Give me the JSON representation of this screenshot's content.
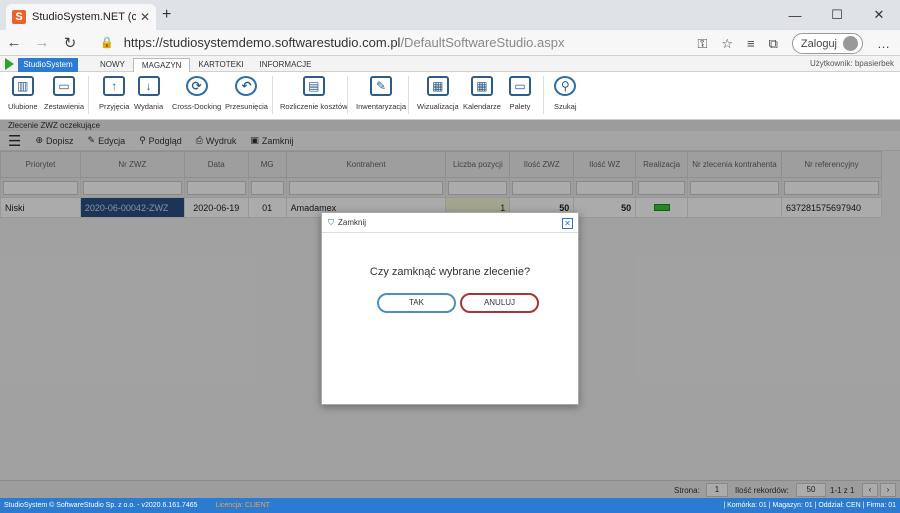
{
  "browser": {
    "tab_title": "StudioSystem.NET (c) SoftwareSt",
    "url_host": "https://studiosystemdemo.softwarestudio.com.pl",
    "url_path": "/DefaultSoftwareStudio.aspx",
    "login_label": "Zaloguj"
  },
  "app": {
    "studio_tab": "StudioSystem",
    "menu": [
      "NOWY",
      "MAGAZYN",
      "KARTOTEKI",
      "INFORMACJE"
    ],
    "active_menu": "MAGAZYN",
    "user": "Użytkownik: bpasierbek"
  },
  "ribbon": [
    {
      "label": "Ulubione",
      "icon": "favorites-icon"
    },
    {
      "label": "Zestawienia",
      "icon": "folder-icon"
    },
    {
      "label": "Przyjęcia",
      "icon": "receipt-in-icon"
    },
    {
      "label": "Wydania",
      "icon": "issue-out-icon"
    },
    {
      "label": "Cross-Docking",
      "icon": "refresh-icon"
    },
    {
      "label": "Przesunięcia",
      "icon": "undo-icon"
    },
    {
      "label": "Rozliczenie kosztów",
      "icon": "cost-icon"
    },
    {
      "label": "Inwentaryzacja",
      "icon": "edit-doc-icon"
    },
    {
      "label": "Wizualizacja",
      "icon": "warehouse-icon"
    },
    {
      "label": "Kalendarze",
      "icon": "calendar-icon"
    },
    {
      "label": "Palety",
      "icon": "pallet-icon"
    },
    {
      "label": "Szukaj",
      "icon": "search-icon"
    }
  ],
  "doc_title": "Zlecenie ZWZ oczekujące",
  "toolbar": {
    "add": "Dopisz",
    "edit": "Edycja",
    "preview": "Podgląd",
    "print": "Wydruk",
    "close": "Zamknij"
  },
  "table": {
    "columns": [
      "Priorytet",
      "Nr ZWZ",
      "Data",
      "MG",
      "Kontrahent",
      "Liczba pozycji",
      "Ilość ZWZ",
      "Ilość WZ",
      "Realizacja",
      "Nr zlecenia kontrahenta",
      "Nr referencyjny"
    ],
    "rows": [
      [
        "Niski",
        "2020-06-00042-ZWZ",
        "2020-06-19",
        "01",
        "Amadamex",
        "1",
        "50",
        "50",
        "",
        "",
        "637281575697940"
      ]
    ]
  },
  "pager": {
    "page_label": "Strona:",
    "page": "1",
    "records_label": "Ilość rekordów:",
    "records": "50",
    "range": "1-1 z 1"
  },
  "dialog": {
    "title": "Zamknij",
    "question": "Czy zamknąć wybrane zlecenie?",
    "ok": "TAK",
    "cancel": "ANULUJ"
  },
  "status": {
    "left": "StudioSystem © SoftwareStudio Sp. z o.o. - v2020.6.161.7465",
    "license": "Licencja: CLIENT",
    "right": "| Komórka: 01 | Magazyn: 01 | Oddział: CEN | Firma: 01"
  }
}
